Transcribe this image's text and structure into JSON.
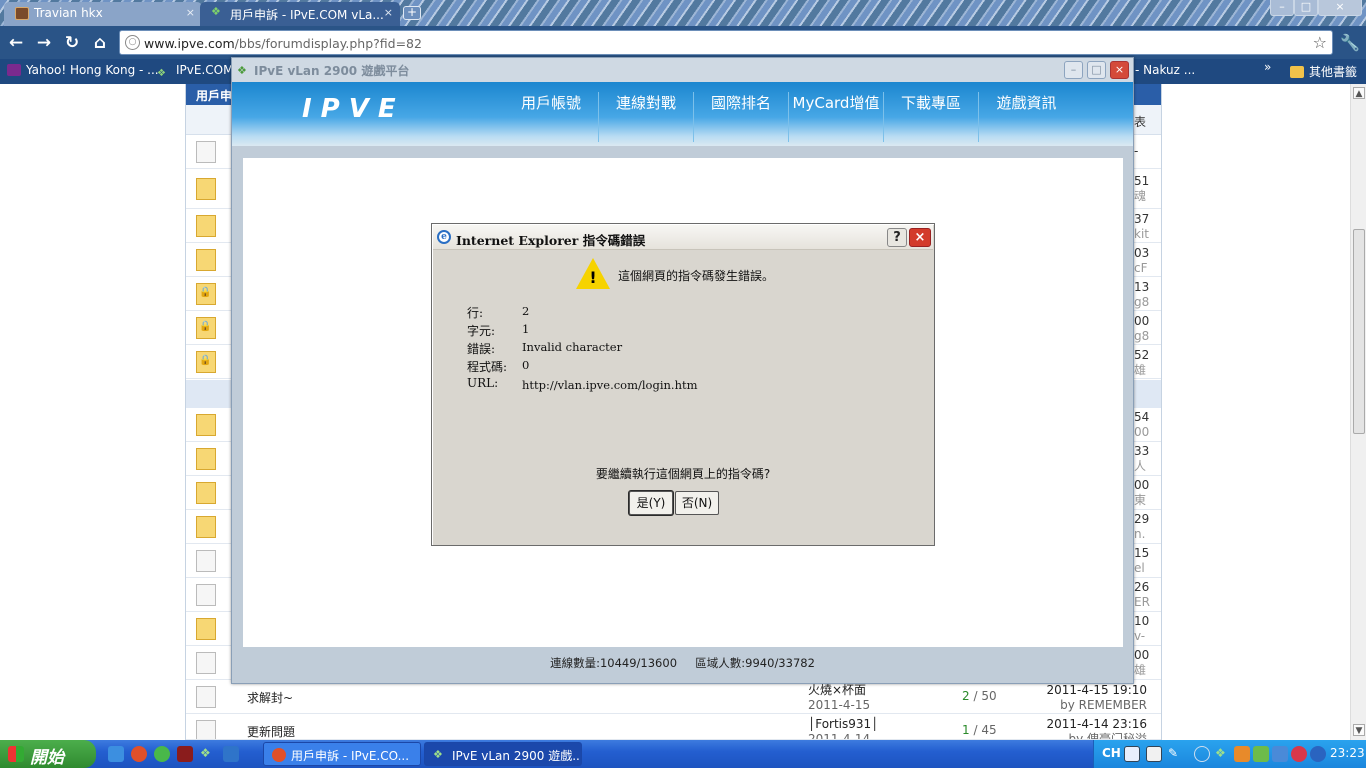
{
  "browser": {
    "tabs": [
      {
        "title": "Travian hkx",
        "close": "×"
      },
      {
        "title": "用戶申訴 - IPvE.COM vLa...",
        "close": "×"
      }
    ],
    "new_tab": "+",
    "url_host": "www.ipve.com",
    "url_path": "/bbs/forumdisplay.php?fid=82",
    "bookmarks": [
      {
        "label": "Yahoo! Hong Kong - ..."
      },
      {
        "label": "IPvE.COM"
      },
      {
        "label": "- Nakuz ..."
      },
      {
        "label": "»"
      },
      {
        "label": "其他書籤"
      }
    ],
    "window_buttons": {
      "min": "–",
      "max": "□",
      "close": "×"
    }
  },
  "forum": {
    "header_label": "用戶申",
    "col_right": "表",
    "row_snippets": [
      {
        "a": "-",
        "b": ""
      },
      {
        "a": "51",
        "b": "魂"
      },
      {
        "a": "37",
        "b": "kit"
      },
      {
        "a": "03",
        "b": "cF"
      },
      {
        "a": "13",
        "b": "g8"
      },
      {
        "a": "00",
        "b": "g8"
      },
      {
        "a": "52",
        "b": "雄"
      },
      {
        "a": "54",
        "b": "00"
      },
      {
        "a": "33",
        "b": "人"
      },
      {
        "a": "00",
        "b": "東"
      },
      {
        "a": "29",
        "b": "n."
      },
      {
        "a": "15",
        "b": "el"
      },
      {
        "a": "26",
        "b": "ER"
      },
      {
        "a": "10",
        "b": "v-"
      },
      {
        "a": "00",
        "b": "雄"
      }
    ],
    "rows": [
      {
        "title": "求解封~",
        "author": "火燒×杯面",
        "author_date": "2011-4-15",
        "replies": "2",
        "views": "50",
        "last": "2011-4-15 19:10",
        "last_by": "by REMEMBER"
      },
      {
        "title": "更新問題",
        "author": "│Fortis931│",
        "author_date": "2011-4-14",
        "replies": "1",
        "views": "45",
        "last": "2011-4-14 23:16",
        "last_by": "by 俾豪门秘溢"
      }
    ]
  },
  "vlan": {
    "title": "IPvE vLan 2900 遊戲平台",
    "logo": "IPVE",
    "nav": [
      "用戶帳號",
      "連線對戰",
      "國際排名",
      "MyCard增值",
      "下載專區",
      "遊戲資訊"
    ],
    "status_connections": "連線數量:10449/13600",
    "status_users": "區域人數:9940/33782"
  },
  "dialog": {
    "title": "Internet Explorer 指令碼錯誤",
    "help": "?",
    "close": "×",
    "ie_icon": "e",
    "warn_mark": "!",
    "message": "這個網頁的指令碼發生錯誤。",
    "fields": [
      {
        "key": "行:",
        "value": "2"
      },
      {
        "key": "字元:",
        "value": "1"
      },
      {
        "key": "錯誤:",
        "value": "Invalid character"
      },
      {
        "key": "程式碼:",
        "value": "0"
      },
      {
        "key": "URL:",
        "value": "http://vlan.ipve.com/login.htm"
      }
    ],
    "question": "要繼續執行這個網頁上的指令碼?",
    "yes": "是(Y)",
    "no": "否(N)"
  },
  "taskbar": {
    "start": "開始",
    "tasks": [
      {
        "label": "用戶申訴 - IPvE.CO..."
      },
      {
        "label": "IPvE vLan 2900 遊戲..."
      }
    ],
    "lang": "CH",
    "clock": "23:23"
  },
  "colors": {
    "taskbar_blue": "#245fd0",
    "start_green": "#3a963a",
    "vlan_nav_blue": "#1b86cf",
    "error_red": "#d33b2b",
    "warning_yellow": "#f6d300"
  }
}
